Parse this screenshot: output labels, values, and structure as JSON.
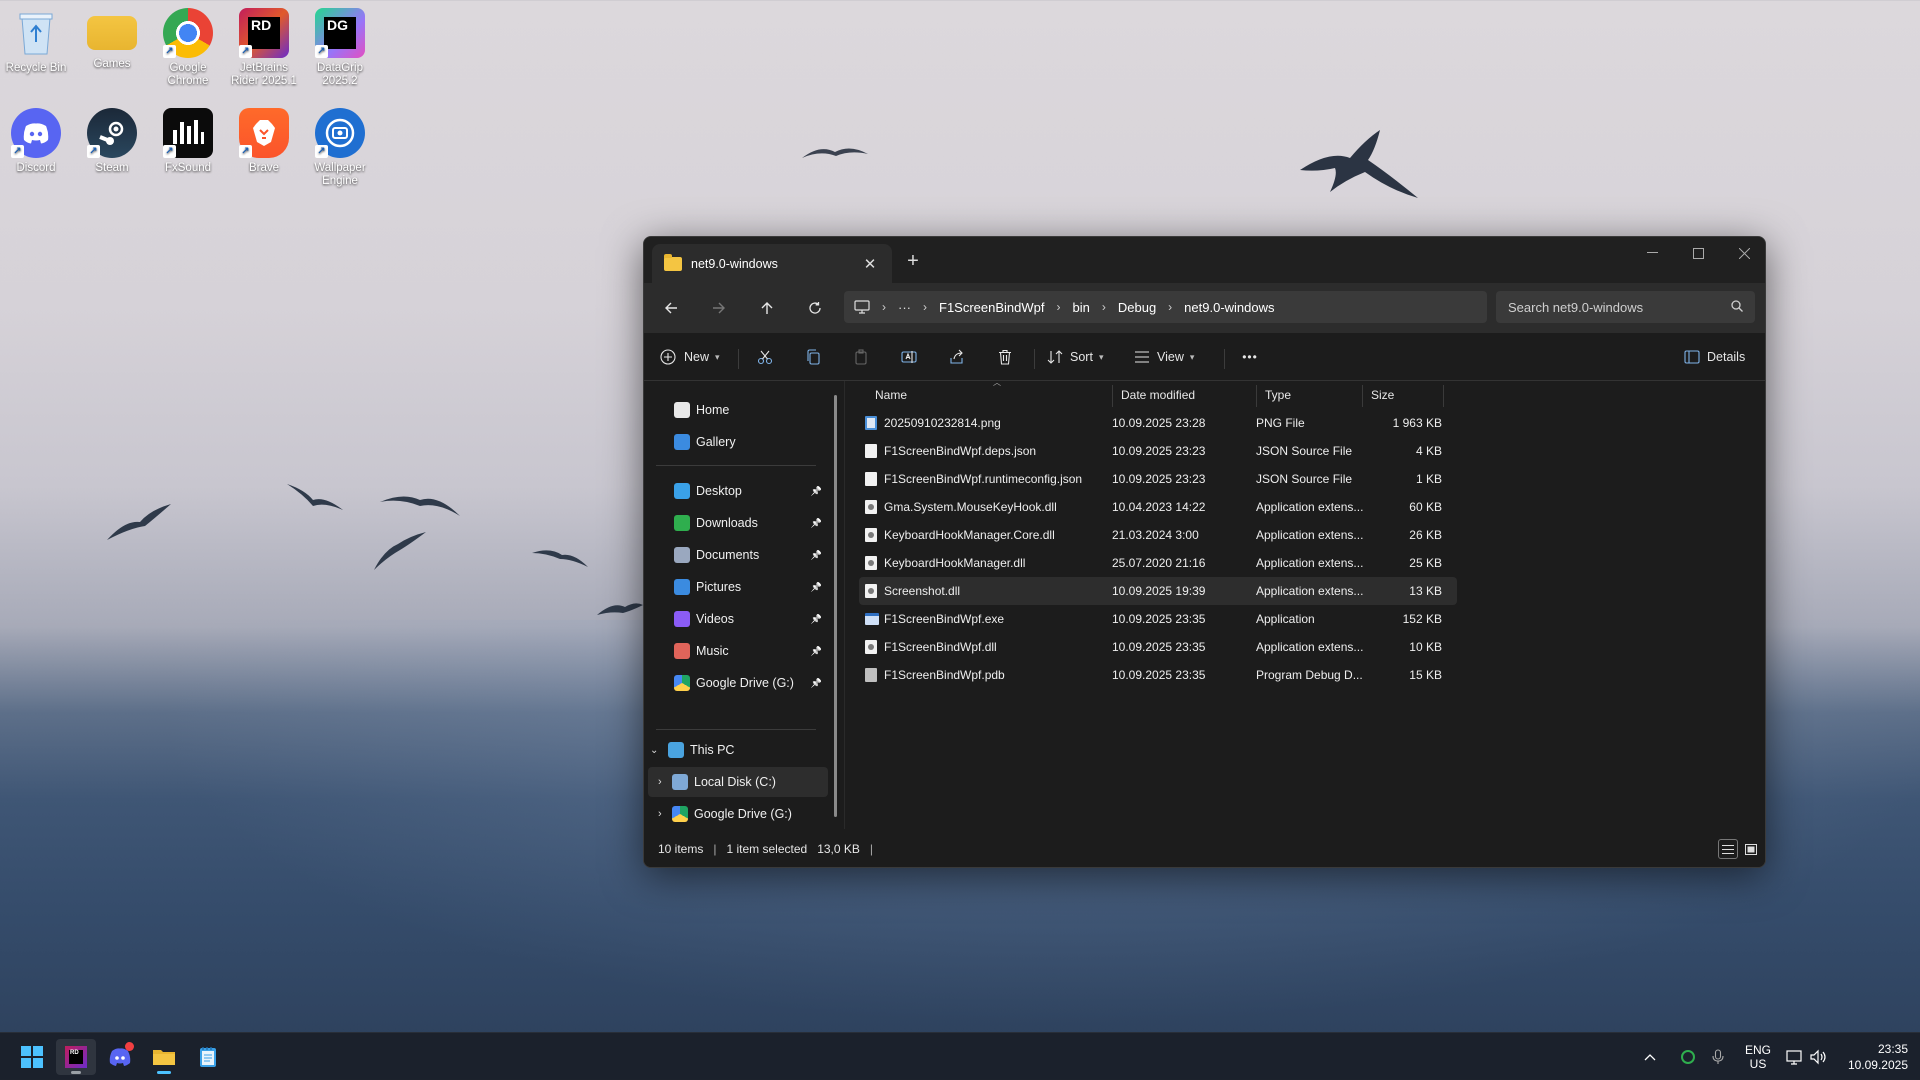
{
  "desktop": {
    "icons": [
      {
        "label_lines": [
          "Recycle Bin"
        ],
        "icon": "recycle-bin-icon"
      },
      {
        "label_lines": [
          "Games"
        ],
        "icon": "folder-icon"
      },
      {
        "label_lines": [
          "Google",
          "Chrome"
        ],
        "icon": "chrome-icon"
      },
      {
        "label_lines": [
          "JetBrains",
          "Rider 2025.1"
        ],
        "icon": "rider-icon",
        "glyph": "RD"
      },
      {
        "label_lines": [
          "DataGrip",
          "2025.2"
        ],
        "icon": "datagrip-icon",
        "glyph": "DG"
      },
      {
        "label_lines": [
          "Discord"
        ],
        "icon": "discord-icon"
      },
      {
        "label_lines": [
          "Steam"
        ],
        "icon": "steam-icon"
      },
      {
        "label_lines": [
          "FxSound"
        ],
        "icon": "fxsound-icon"
      },
      {
        "label_lines": [
          "Brave"
        ],
        "icon": "brave-icon"
      },
      {
        "label_lines": [
          "Wallpaper",
          "Engine"
        ],
        "icon": "wallpaper-engine-icon"
      }
    ]
  },
  "window": {
    "tab_title": "net9.0-windows",
    "new_tab_symbol": "+",
    "breadcrumbs": [
      "F1ScreenBindWpf",
      "bin",
      "Debug",
      "net9.0-windows"
    ],
    "search_placeholder": "Search net9.0-windows",
    "toolbar": {
      "new_label": "New",
      "sort_label": "Sort",
      "view_label": "View",
      "more_label": "•••",
      "details_label": "Details"
    },
    "sidebar": {
      "quick": [
        {
          "label": "Home",
          "icon": "home-icon"
        },
        {
          "label": "Gallery",
          "icon": "gallery-icon"
        }
      ],
      "pinned": [
        {
          "label": "Desktop",
          "icon": "desktop-icon"
        },
        {
          "label": "Downloads",
          "icon": "downloads-icon"
        },
        {
          "label": "Documents",
          "icon": "documents-icon"
        },
        {
          "label": "Pictures",
          "icon": "pictures-icon"
        },
        {
          "label": "Videos",
          "icon": "videos-icon"
        },
        {
          "label": "Music",
          "icon": "music-icon"
        },
        {
          "label": "Google Drive (G:)",
          "icon": "google-drive-icon"
        }
      ],
      "this_pc": "This PC",
      "drives": [
        {
          "label": "Local Disk (C:)",
          "icon": "local-disk-icon"
        },
        {
          "label": "Google Drive (G:)",
          "icon": "google-drive-icon"
        }
      ]
    },
    "columns": {
      "name": "Name",
      "date": "Date modified",
      "type": "Type",
      "size": "Size"
    },
    "files": [
      {
        "name": "20250910232814.png",
        "date": "10.09.2025 23:28",
        "type": "PNG File",
        "size": "1 963 KB",
        "kind": "png"
      },
      {
        "name": "F1ScreenBindWpf.deps.json",
        "date": "10.09.2025 23:23",
        "type": "JSON Source File",
        "size": "4 KB",
        "kind": "json"
      },
      {
        "name": "F1ScreenBindWpf.runtimeconfig.json",
        "date": "10.09.2025 23:23",
        "type": "JSON Source File",
        "size": "1 KB",
        "kind": "json"
      },
      {
        "name": "Gma.System.MouseKeyHook.dll",
        "date": "10.04.2023 14:22",
        "type": "Application extens...",
        "size": "60 KB",
        "kind": "dll"
      },
      {
        "name": "KeyboardHookManager.Core.dll",
        "date": "21.03.2024 3:00",
        "type": "Application extens...",
        "size": "26 KB",
        "kind": "dll"
      },
      {
        "name": "KeyboardHookManager.dll",
        "date": "25.07.2020 21:16",
        "type": "Application extens...",
        "size": "25 KB",
        "kind": "dll"
      },
      {
        "name": "Screenshot.dll",
        "date": "10.09.2025 19:39",
        "type": "Application extens...",
        "size": "13 KB",
        "kind": "dll",
        "selected": true
      },
      {
        "name": "F1ScreenBindWpf.exe",
        "date": "10.09.2025 23:35",
        "type": "Application",
        "size": "152 KB",
        "kind": "exe"
      },
      {
        "name": "F1ScreenBindWpf.dll",
        "date": "10.09.2025 23:35",
        "type": "Application extens...",
        "size": "10 KB",
        "kind": "dll"
      },
      {
        "name": "F1ScreenBindWpf.pdb",
        "date": "10.09.2025 23:35",
        "type": "Program Debug D...",
        "size": "15 KB",
        "kind": "pdb"
      }
    ],
    "status": {
      "items": "10 items",
      "selected": "1 item selected",
      "selected_size": "13,0 KB"
    }
  },
  "taskbar": {
    "lang_primary": "ENG",
    "lang_secondary": "US",
    "time": "23:35",
    "date": "10.09.2025"
  },
  "colors": {
    "window_bg": "#1c1c1c",
    "nav_bg": "#2c2c2c",
    "folder_yellow": "#f4c542",
    "taskbar_bg": "#1a1e28"
  }
}
